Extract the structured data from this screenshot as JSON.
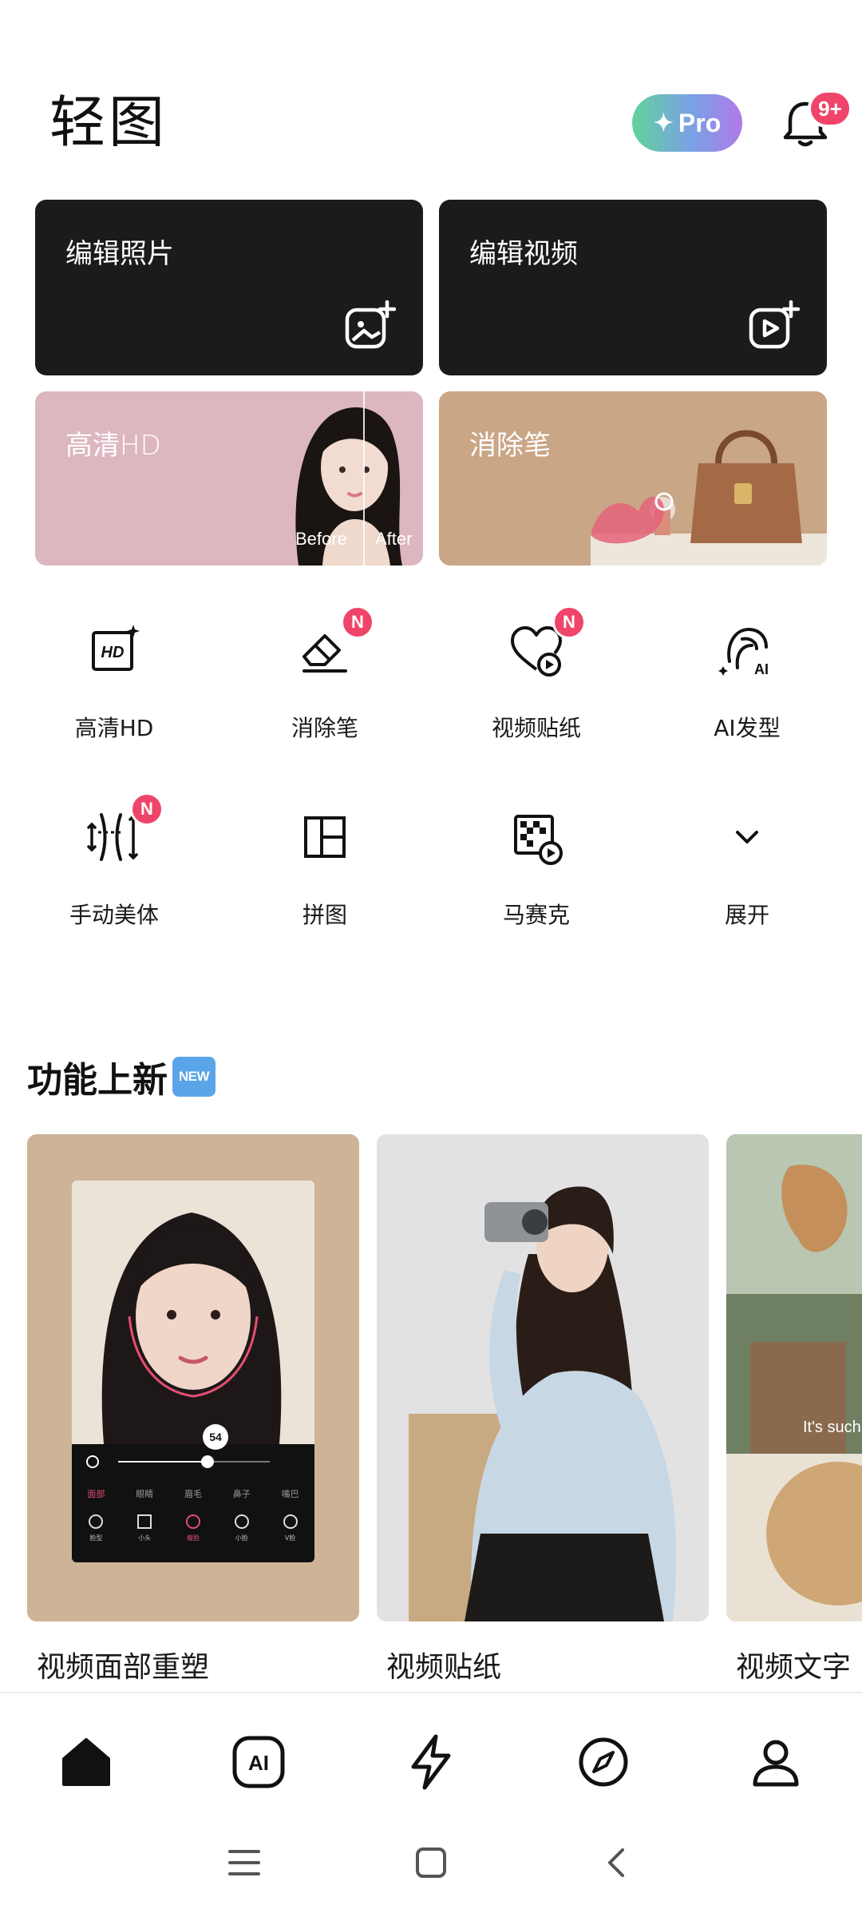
{
  "app": {
    "logo_text": "轻图"
  },
  "header": {
    "pro_label": "Pro",
    "pro_icon": "sparkle-icon",
    "notification_icon": "bell-icon",
    "notification_badge": "9+",
    "colors": {
      "badge": "#f0456a",
      "pro_start": "#62d29a",
      "pro_end": "#b07ae8"
    }
  },
  "main_cards": {
    "edit_photo": {
      "label": "编辑照片",
      "icon": "add-image-icon"
    },
    "edit_video": {
      "label": "编辑视频",
      "icon": "add-video-icon"
    },
    "hd": {
      "label": "高清HD",
      "before": "Before",
      "after": "After"
    },
    "eraser": {
      "label": "消除笔"
    }
  },
  "tools": [
    {
      "label": "高清HD",
      "icon": "hd-icon",
      "badge": ""
    },
    {
      "label": "消除笔",
      "icon": "eraser-icon",
      "badge": "N"
    },
    {
      "label": "视频贴纸",
      "icon": "heart-play-icon",
      "badge": "N"
    },
    {
      "label": "AI发型",
      "icon": "ai-hair-icon",
      "badge": ""
    },
    {
      "label": "手动美体",
      "icon": "body-reshape-icon",
      "badge": "N"
    },
    {
      "label": "拼图",
      "icon": "collage-icon",
      "badge": ""
    },
    {
      "label": "马赛克",
      "icon": "mosaic-icon",
      "badge": ""
    },
    {
      "label": "展开",
      "icon": "chevron-down-icon",
      "badge": ""
    }
  ],
  "new_features": {
    "title": "功能上新",
    "new_tag": "NEW",
    "items": [
      {
        "label": "视频面部重塑",
        "slider_value": "54",
        "tabs": [
          "面部",
          "眼睛",
          "眉毛",
          "鼻子",
          "嘴巴"
        ],
        "tools": [
          "脸型",
          "小头",
          "瘦脸",
          "小脸",
          "V脸"
        ]
      },
      {
        "label": "视频贴纸"
      },
      {
        "label": "视频文字",
        "caption": "It's such"
      }
    ]
  },
  "bottom_nav": [
    {
      "name": "home",
      "icon": "home-icon"
    },
    {
      "name": "ai",
      "icon": "ai-icon"
    },
    {
      "name": "quick",
      "icon": "lightning-icon"
    },
    {
      "name": "discover",
      "icon": "compass-icon"
    },
    {
      "name": "profile",
      "icon": "person-icon"
    }
  ],
  "system_nav": [
    "menu-icon",
    "square-icon",
    "back-icon"
  ]
}
